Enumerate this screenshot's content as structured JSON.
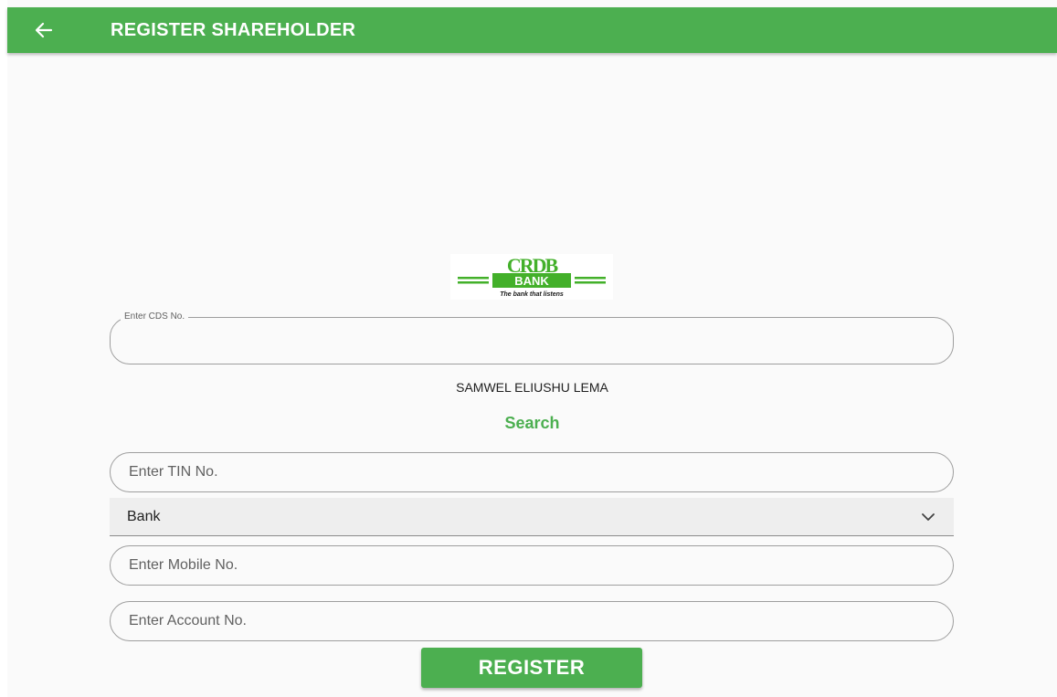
{
  "appbar": {
    "title": "REGISTER SHAREHOLDER",
    "back_icon": "arrow-left-icon",
    "color": "#4caf50"
  },
  "logo": {
    "brand_letters": "CRDB",
    "badge": "BANK",
    "tagline": "The bank that listens",
    "brand_color": "#43b02a"
  },
  "form": {
    "cds": {
      "label": "Enter CDS No.",
      "value": ""
    },
    "shareholder_name": "SAMWEL ELIUSHU LEMA",
    "search_label": "Search",
    "tin": {
      "placeholder": "Enter TIN No.",
      "value": ""
    },
    "bank": {
      "selected": "Bank",
      "icon": "chevron-down-icon"
    },
    "mobile": {
      "placeholder": "Enter Mobile No.",
      "value": ""
    },
    "account": {
      "placeholder": "Enter Account No.",
      "value": ""
    },
    "register_label": "REGISTER"
  }
}
